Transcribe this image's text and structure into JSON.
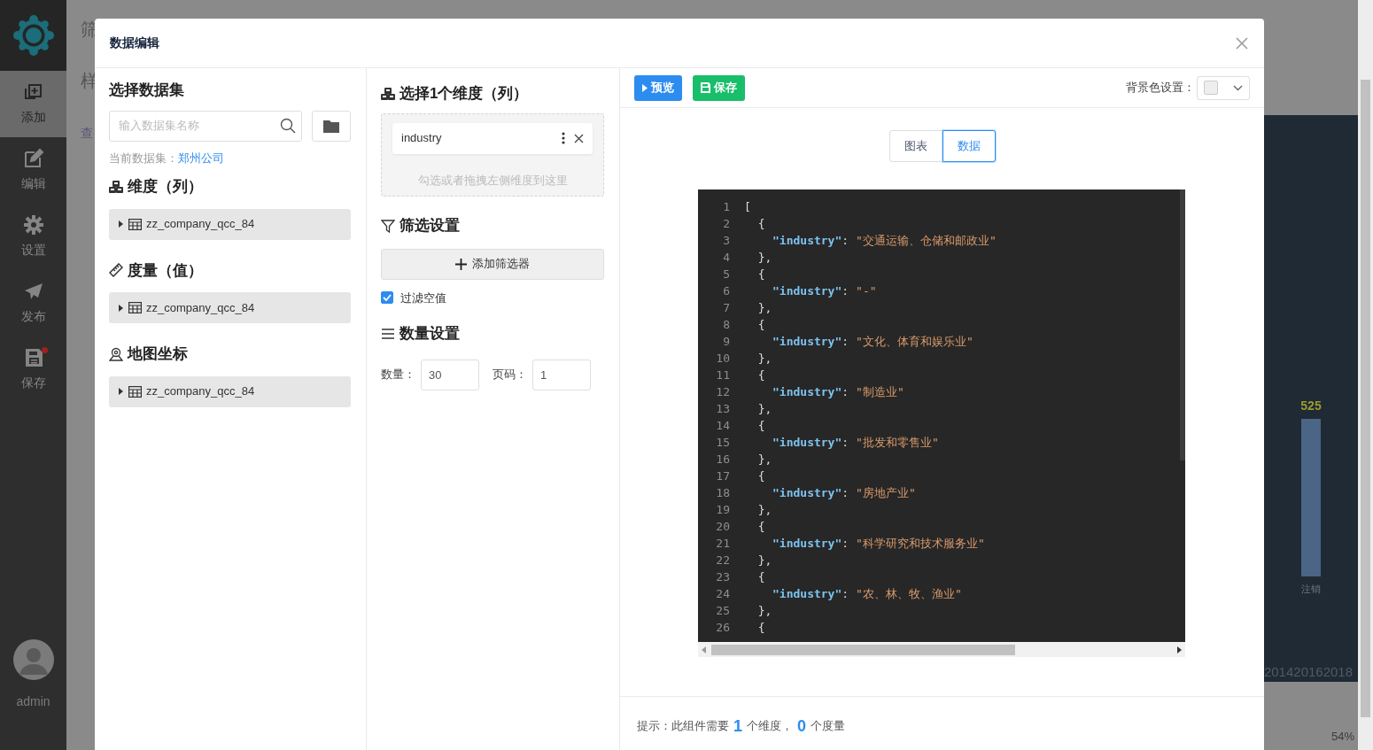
{
  "sidebar": {
    "items": [
      {
        "kind": "add",
        "label": "添加",
        "selected": true,
        "badge": false
      },
      {
        "kind": "edit",
        "label": "编辑",
        "selected": false,
        "badge": false
      },
      {
        "kind": "settings",
        "label": "设置",
        "selected": false,
        "badge": false
      },
      {
        "kind": "publish",
        "label": "发布",
        "selected": false,
        "badge": false
      },
      {
        "kind": "save",
        "label": "保存",
        "selected": false,
        "badge": true
      }
    ],
    "user": {
      "name": "admin"
    }
  },
  "background": {
    "fragments": [
      "筛",
      "样",
      "查"
    ],
    "bar_value": "525",
    "bar_label": "注销",
    "years": [
      "2014",
      "2016",
      "2018"
    ],
    "zoom": "54%"
  },
  "dialog": {
    "title": "数据编辑",
    "dataset_panel": {
      "title": "选择数据集",
      "search": {
        "placeholder": "输入数据集名称"
      },
      "current_label": "当前数据集：",
      "current_value": "郑州公司",
      "sections": [
        {
          "kind": "dimension",
          "title": "维度（列）",
          "items": [
            {
              "label": "zz_company_qcc_84",
              "expanded": false
            }
          ]
        },
        {
          "kind": "measure",
          "title": "度量（值）",
          "items": [
            {
              "label": "zz_company_qcc_84",
              "expanded": false
            }
          ]
        },
        {
          "kind": "map",
          "title": "地图坐标",
          "items": [
            {
              "label": "zz_company_qcc_84",
              "expanded": false
            }
          ]
        }
      ]
    },
    "config_panel": {
      "dimension_title": "选择1个维度（列）",
      "chips": [
        {
          "label": "industry"
        }
      ],
      "drop_hint": "勾选或者拖拽左侧维度到这里",
      "filter_title": "筛选设置",
      "add_filter": "添加筛选器",
      "filter_empty": {
        "label": "过滤空值",
        "checked": true
      },
      "count_title": "数量设置",
      "fields": [
        {
          "label": "数量：",
          "value": "30"
        },
        {
          "label": "页码：",
          "value": "1"
        }
      ]
    },
    "preview_panel": {
      "buttons": [
        {
          "kind": "preview",
          "label": "预览"
        },
        {
          "kind": "save",
          "label": "保存"
        }
      ],
      "bg_label": "背景色设置：",
      "tabs": [
        {
          "label": "图表",
          "selected": false
        },
        {
          "label": "数据",
          "selected": true
        }
      ],
      "code_lines": [
        {
          "num": "1",
          "kind": "punct",
          "text": "["
        },
        {
          "num": "2",
          "kind": "punct",
          "text": "  {"
        },
        {
          "num": "3",
          "kind": "pair",
          "key": "\"industry\"",
          "sep": ":",
          "value": "\"交通运输、仓储和邮政业\""
        },
        {
          "num": "4",
          "kind": "punct",
          "text": "  },"
        },
        {
          "num": "5",
          "kind": "punct",
          "text": "  {"
        },
        {
          "num": "6",
          "kind": "pair",
          "key": "\"industry\"",
          "sep": ":",
          "value": "\"-\""
        },
        {
          "num": "7",
          "kind": "punct",
          "text": "  },"
        },
        {
          "num": "8",
          "kind": "punct",
          "text": "  {"
        },
        {
          "num": "9",
          "kind": "pair",
          "key": "\"industry\"",
          "sep": ":",
          "value": "\"文化、体育和娱乐业\""
        },
        {
          "num": "10",
          "kind": "punct",
          "text": "  },"
        },
        {
          "num": "11",
          "kind": "punct",
          "text": "  {"
        },
        {
          "num": "12",
          "kind": "pair",
          "key": "\"industry\"",
          "sep": ":",
          "value": "\"制造业\""
        },
        {
          "num": "13",
          "kind": "punct",
          "text": "  },"
        },
        {
          "num": "14",
          "kind": "punct",
          "text": "  {"
        },
        {
          "num": "15",
          "kind": "pair",
          "key": "\"industry\"",
          "sep": ":",
          "value": "\"批发和零售业\""
        },
        {
          "num": "16",
          "kind": "punct",
          "text": "  },"
        },
        {
          "num": "17",
          "kind": "punct",
          "text": "  {"
        },
        {
          "num": "18",
          "kind": "pair",
          "key": "\"industry\"",
          "sep": ":",
          "value": "\"房地产业\""
        },
        {
          "num": "19",
          "kind": "punct",
          "text": "  },"
        },
        {
          "num": "20",
          "kind": "punct",
          "text": "  {"
        },
        {
          "num": "21",
          "kind": "pair",
          "key": "\"industry\"",
          "sep": ":",
          "value": "\"科学研究和技术服务业\""
        },
        {
          "num": "22",
          "kind": "punct",
          "text": "  },"
        },
        {
          "num": "23",
          "kind": "punct",
          "text": "  {"
        },
        {
          "num": "24",
          "kind": "pair",
          "key": "\"industry\"",
          "sep": ":",
          "value": "\"农、林、牧、渔业\""
        },
        {
          "num": "25",
          "kind": "punct",
          "text": "  },"
        },
        {
          "num": "26",
          "kind": "punct",
          "text": "  {"
        }
      ],
      "hint": [
        {
          "kind": "text",
          "text": "提示：此组件需要"
        },
        {
          "kind": "count",
          "text": "1"
        },
        {
          "kind": "text",
          "text": "个维度，"
        },
        {
          "kind": "count",
          "text": "0"
        },
        {
          "kind": "text",
          "text": "个度量"
        }
      ]
    }
  }
}
